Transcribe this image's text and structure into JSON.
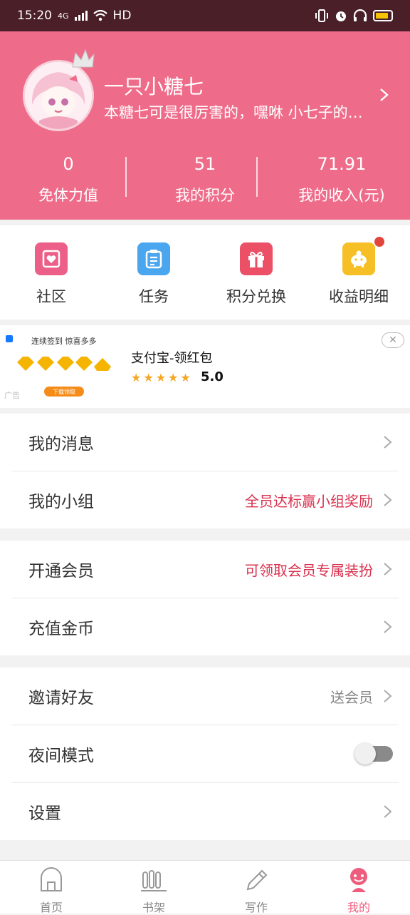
{
  "status_bar": {
    "time": "15:20",
    "network": "4G",
    "hd": "HD"
  },
  "profile": {
    "name": "一只小糖七",
    "bio": "本糖七可是很厉害的，嘿咻 小七子的…"
  },
  "stats": [
    {
      "value": "0",
      "label": "免体力值"
    },
    {
      "value": "51",
      "label": "我的积分"
    },
    {
      "value": "71.91",
      "label": "我的收入(元)"
    }
  ],
  "quick_links": [
    {
      "label": "社区",
      "icon": "heart-card-icon",
      "color": "#ec5f88"
    },
    {
      "label": "任务",
      "icon": "clipboard-icon",
      "color": "#4aa6ef"
    },
    {
      "label": "积分兑换",
      "icon": "gift-icon",
      "color": "#ec5066"
    },
    {
      "label": "收益明细",
      "icon": "piggy-bank-icon",
      "color": "#f7bf26"
    }
  ],
  "ad": {
    "banner_title": "连续签到 惊喜多多",
    "banner_button": "下载领取",
    "tag": "广告",
    "title": "支付宝-领红包",
    "stars": "★★★★★",
    "rating": "5.0"
  },
  "menu_groups": [
    [
      {
        "label": "我的消息",
        "extra": ""
      },
      {
        "label": "我的小组",
        "extra": "全员达标赢小组奖励"
      }
    ],
    [
      {
        "label": "开通会员",
        "extra": "可领取会员专属装扮"
      },
      {
        "label": "充值金币",
        "extra": ""
      }
    ],
    [
      {
        "label": "邀请好友",
        "extra": "送会员"
      },
      {
        "label": "夜间模式",
        "toggle": false
      },
      {
        "label": "设置",
        "extra": ""
      }
    ]
  ],
  "tabs": [
    {
      "label": "首页",
      "icon": "home-icon"
    },
    {
      "label": "书架",
      "icon": "bookshelf-icon"
    },
    {
      "label": "写作",
      "icon": "pen-icon"
    },
    {
      "label": "我的",
      "icon": "profile-icon",
      "active": true
    }
  ],
  "colors": {
    "header": "#ee6c8a",
    "accent_red": "#d9314e",
    "tab_active": "#ee5d7e"
  }
}
